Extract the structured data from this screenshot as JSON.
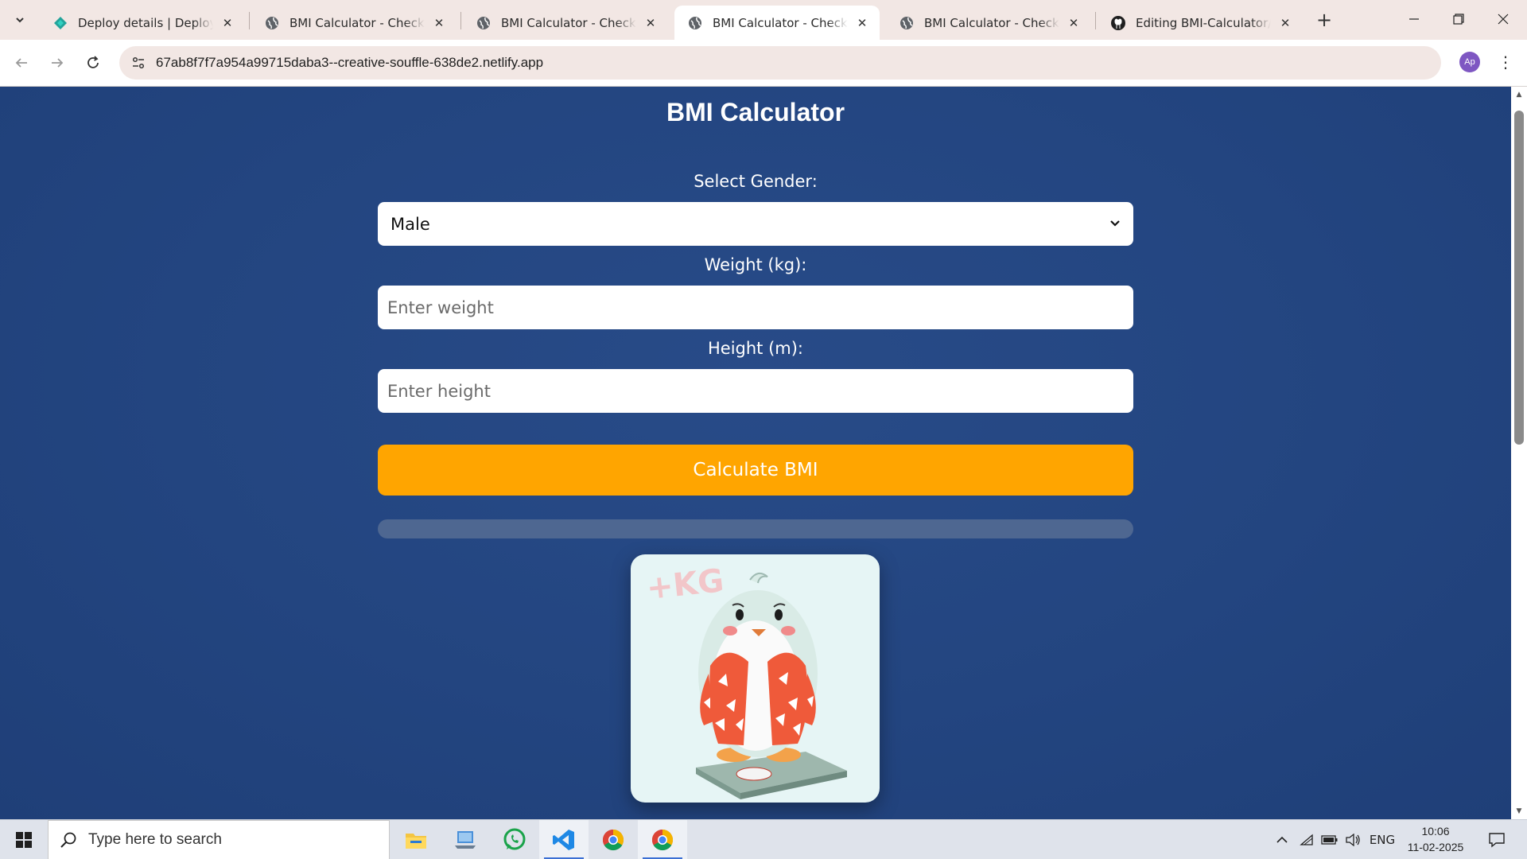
{
  "browser": {
    "tabs": [
      {
        "title": "Deploy details | Deploys | c",
        "favicon": "netlify-icon",
        "active": false
      },
      {
        "title": "BMI Calculator - Check You",
        "favicon": "globe-icon",
        "active": false
      },
      {
        "title": "BMI Calculator - Check You",
        "favicon": "globe-icon",
        "active": false
      },
      {
        "title": "BMI Calculator - Check You",
        "favicon": "globe-icon",
        "active": true
      },
      {
        "title": "BMI Calculator - Check You",
        "favicon": "globe-icon",
        "active": false
      },
      {
        "title": "Editing BMI-Calculator/RE",
        "favicon": "github-icon",
        "active": false
      }
    ],
    "url": "67ab8f7f7a954a99715daba3--creative-souffle-638de2.netlify.app",
    "profile_initials": "Ap"
  },
  "page": {
    "title": "BMI Calculator",
    "gender_label": "Select Gender:",
    "gender_value": "Male",
    "weight_label": "Weight (kg):",
    "weight_placeholder": "Enter weight",
    "height_label": "Height (m):",
    "height_placeholder": "Enter height",
    "calculate_label": "Calculate BMI",
    "result_progress": 0,
    "image_text": "+KG"
  },
  "taskbar": {
    "search_placeholder": "Type here to search",
    "apps": [
      "file-explorer-icon",
      "computer-icon",
      "whatsapp-icon",
      "vscode-icon",
      "chrome-icon",
      "chrome-icon"
    ],
    "language": "ENG",
    "time": "10:06",
    "date": "11-02-2025"
  },
  "colors": {
    "page_background": "#234580",
    "button": "#ffa500",
    "tab_strip": "#f2e7e4"
  }
}
